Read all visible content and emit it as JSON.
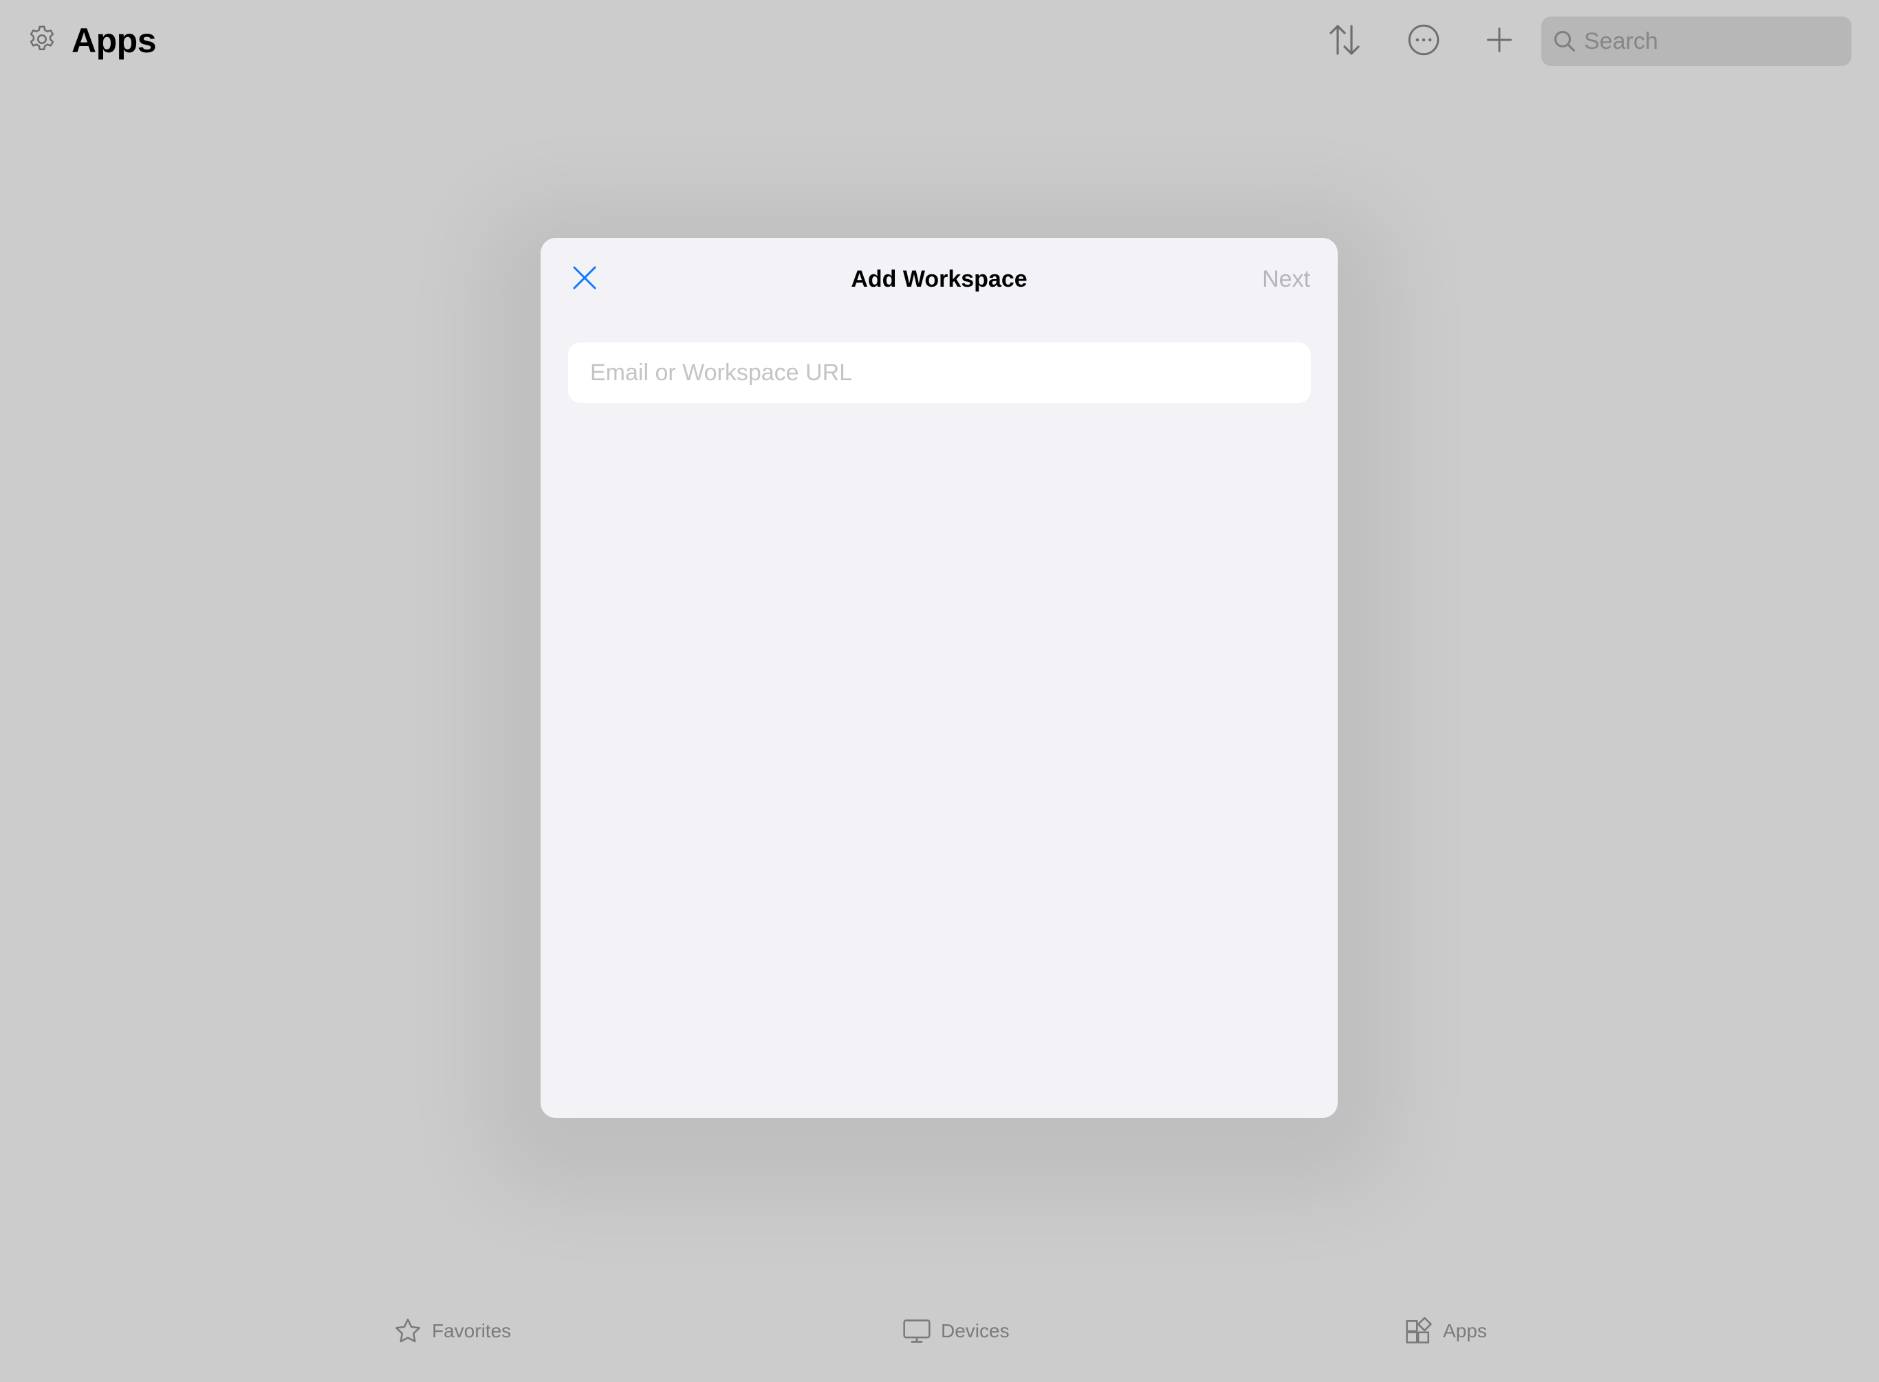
{
  "header": {
    "title": "Apps",
    "settings_icon": "gear-icon",
    "sort_icon": "sort-arrows-icon",
    "more_icon": "ellipsis-circle-icon",
    "add_icon": "plus-icon",
    "search": {
      "placeholder": "Search",
      "icon": "search-icon"
    }
  },
  "modal": {
    "title": "Add Workspace",
    "close_icon": "close-icon",
    "next_label": "Next",
    "input": {
      "placeholder": "Email or Workspace URL",
      "value": ""
    }
  },
  "tabs": [
    {
      "label": "Favorites",
      "icon": "star-icon"
    },
    {
      "label": "Devices",
      "icon": "monitor-icon"
    },
    {
      "label": "Apps",
      "icon": "apps-grid-icon"
    }
  ],
  "colors": {
    "accent": "#0a7aff",
    "background": "#cccccc",
    "modal_background": "#f2f2f7",
    "disabled_text": "#b5b5ba"
  }
}
